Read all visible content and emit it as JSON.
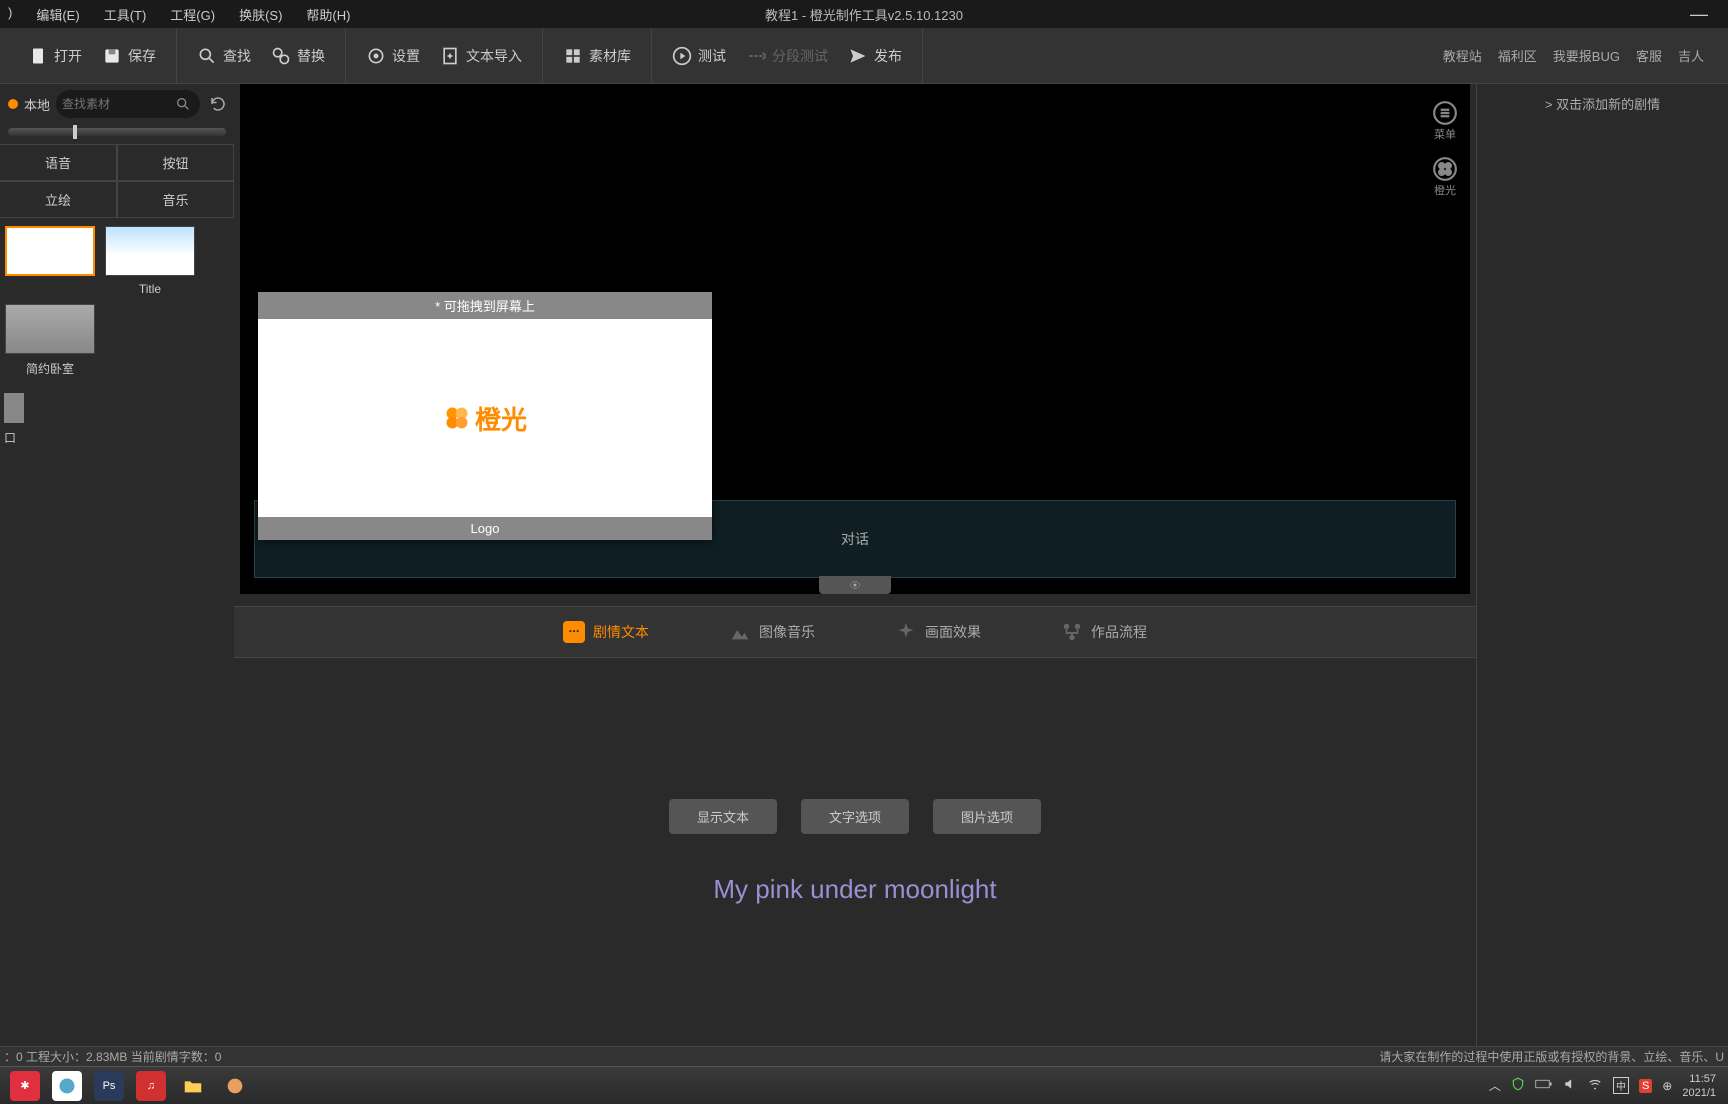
{
  "titlebar": {
    "title": "教程1 - 橙光制作工具v2.5.10.1230"
  },
  "menu": {
    "file": ")",
    "edit": "编辑(E)",
    "tools": "工具(T)",
    "project": "工程(G)",
    "skin": "换肤(S)",
    "help": "帮助(H)"
  },
  "toolbar": {
    "open": "打开",
    "save": "保存",
    "find": "查找",
    "replace": "替换",
    "settings": "设置",
    "import": "文本导入",
    "assets": "素材库",
    "test": "测试",
    "segtest": "分段测试",
    "publish": "发布"
  },
  "links": {
    "tutorials": "教程站",
    "welfare": "福利区",
    "bug": "我要报BUG",
    "service": "客服",
    "user": "吉人"
  },
  "left": {
    "local": "本地",
    "search_ph": "查找素材",
    "tabs": {
      "voice": "语音",
      "button": "按钮",
      "sprite": "立绘",
      "music": "音乐"
    },
    "thumbs": {
      "title": "Title",
      "bedroom": "简约卧室",
      "port": "口"
    }
  },
  "canvas": {
    "dialog": "对话",
    "menu": "菜单",
    "brand": "橙光"
  },
  "preview": {
    "header": "* 可拖拽到屏幕上",
    "logo_text": "橙光",
    "footer": "Logo"
  },
  "midtabs": {
    "text": "剧情文本",
    "image": "图像音乐",
    "effect": "画面效果",
    "flow": "作品流程"
  },
  "actions": {
    "show": "显示文本",
    "textopt": "文字选项",
    "imgopt": "图片选项"
  },
  "watermark": "My pink under moonlight",
  "right": {
    "hint": "> 双击添加新的剧情"
  },
  "status": {
    "left": "：0  工程大小：2.83MB  当前剧情字数：0",
    "right": "请大家在制作的过程中使用正版或有授权的背景、立绘、音乐、U"
  },
  "clock": {
    "time": "11:57",
    "date": "2021/1"
  }
}
